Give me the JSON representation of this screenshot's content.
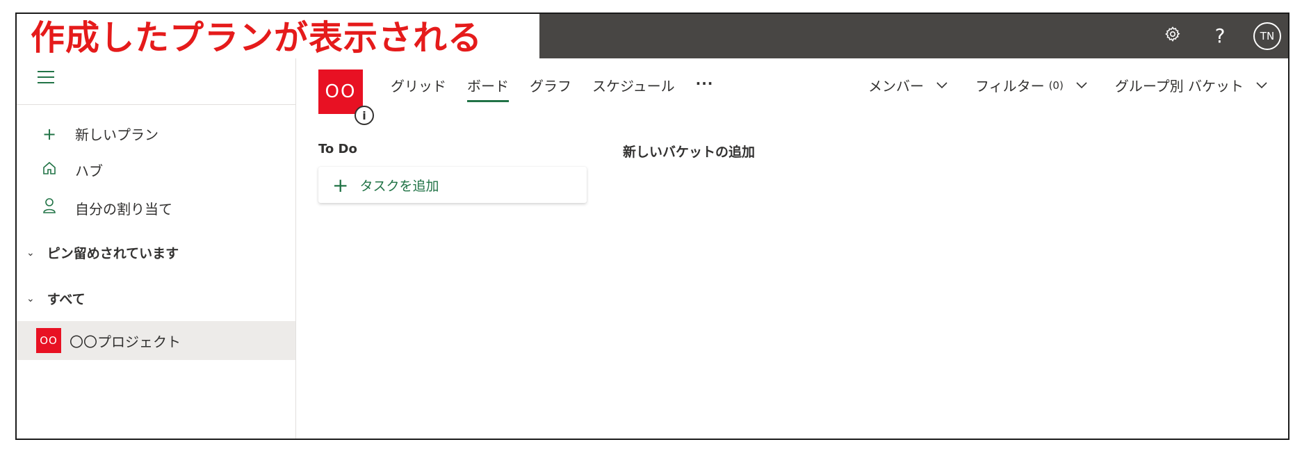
{
  "banner": {
    "text": "作成したプランが表示される"
  },
  "topbar": {
    "settings_icon": "gear-icon",
    "help_icon": "help-icon",
    "help_glyph": "?",
    "avatar_initials": "TN"
  },
  "sidebar": {
    "menu_icon": "hamburger-icon",
    "items": [
      {
        "icon": "plus-icon",
        "glyph": "+",
        "label": "新しいプラン"
      },
      {
        "icon": "home-icon",
        "glyph": "⌂",
        "label": "ハブ"
      },
      {
        "icon": "person-icon",
        "glyph": "♙",
        "label": "自分の割り当て"
      }
    ],
    "sections": [
      {
        "label": "ピン留めされています"
      },
      {
        "label": "すべて"
      }
    ],
    "plans": [
      {
        "thumb": "OO",
        "name": "〇〇プロジェクト",
        "selected": true
      }
    ]
  },
  "main": {
    "plan_logo": "OO",
    "info_glyph": "i",
    "tabs": [
      {
        "label": "グリッド",
        "active": false
      },
      {
        "label": "ボード",
        "active": true
      },
      {
        "label": "グラフ",
        "active": false
      },
      {
        "label": "スケジュール",
        "active": false
      },
      {
        "label": "···",
        "active": false
      }
    ],
    "filters": [
      {
        "label": "メンバー",
        "count": ""
      },
      {
        "label": "フィルター",
        "count": "(0)"
      },
      {
        "label": "グループ別 バケット",
        "count": ""
      }
    ],
    "bucket": {
      "title": "To Do",
      "add_task_label": "タスクを追加"
    },
    "new_bucket_label": "新しいバケットの追加"
  },
  "colors": {
    "accent": "#217346",
    "plan": "#e81123",
    "topbar": "#484644",
    "banner_text": "#e51b1b"
  }
}
